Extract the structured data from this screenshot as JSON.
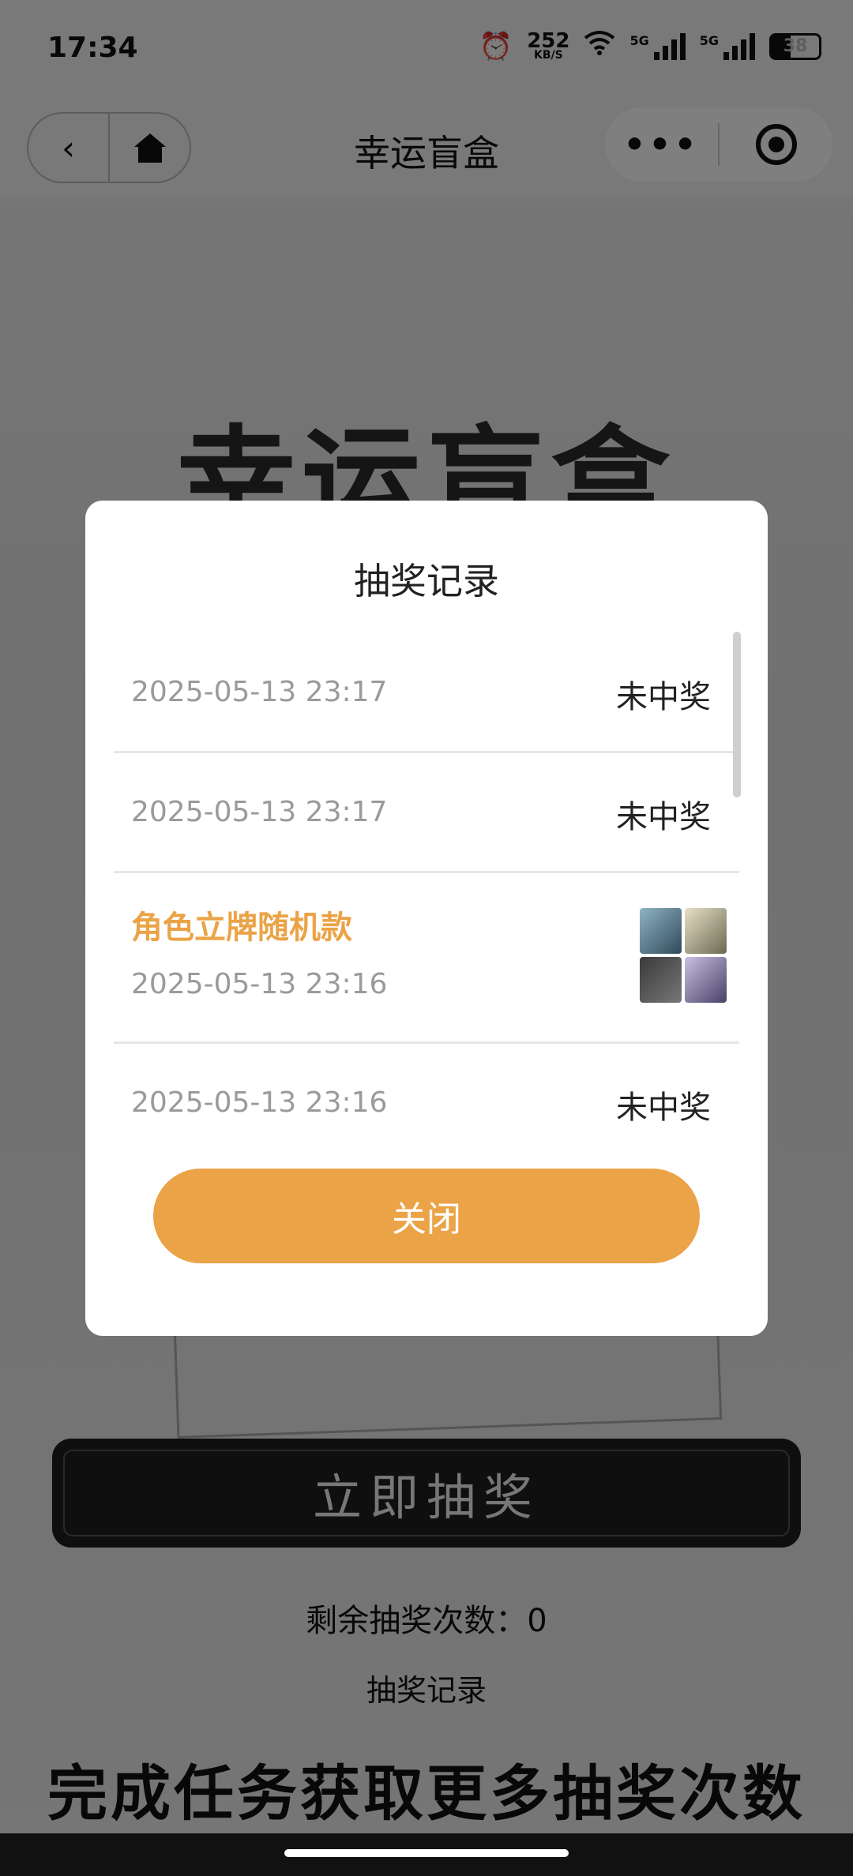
{
  "status_bar": {
    "time": "17:34",
    "net_speed": "252",
    "net_unit": "KB/S",
    "signal_1": "5G",
    "signal_2": "5G",
    "battery": "38"
  },
  "nav": {
    "title": "幸运盲盒",
    "more_label": "•••"
  },
  "background": {
    "hero_title": "幸运盲盒",
    "draw_button": "立即抽奖",
    "remaining_label": "剩余抽奖次数：0",
    "record_link": "抽奖记录",
    "task_title": "完成任务获取更多抽奖次数"
  },
  "modal": {
    "title": "抽奖记录",
    "records": [
      {
        "date": "2025-05-13 23:17",
        "result": "未中奖"
      },
      {
        "date": "2025-05-13 23:17",
        "result": "未中奖"
      },
      {
        "prize": "角色立牌随机款",
        "date": "2025-05-13 23:16"
      },
      {
        "date": "2025-05-13 23:16",
        "result": "未中奖"
      }
    ],
    "close_label": "关闭"
  },
  "colors": {
    "accent": "#eba347",
    "mask": "rgba(0,0,0,0.5)",
    "draw_button_bg": "#1e1e1e"
  }
}
